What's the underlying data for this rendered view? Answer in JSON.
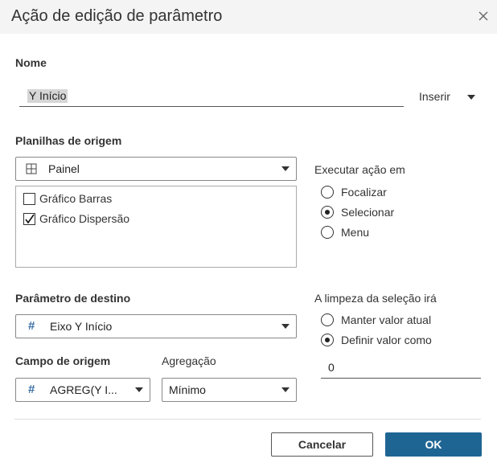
{
  "dialog": {
    "title": "Ação de edição de parâmetro",
    "close_icon": "close-icon"
  },
  "name_section": {
    "label": "Nome",
    "value": "Y Início",
    "insert_label": "Inserir"
  },
  "source_sheets": {
    "label": "Planilhas de origem",
    "selected": "Painel",
    "icon": "grid-icon",
    "items": [
      {
        "label": "Gráfico Barras",
        "checked": false
      },
      {
        "label": "Gráfico Dispersão",
        "checked": true
      }
    ]
  },
  "run_action": {
    "label": "Executar ação em",
    "options": [
      {
        "label": "Focalizar",
        "selected": false
      },
      {
        "label": "Selecionar",
        "selected": true
      },
      {
        "label": "Menu",
        "selected": false
      }
    ]
  },
  "target_parameter": {
    "label": "Parâmetro de destino",
    "selected": "Eixo Y Início",
    "icon": "number-icon"
  },
  "source_field": {
    "label": "Campo de origem",
    "selected": "AGREG(Y I...",
    "icon": "number-icon"
  },
  "aggregation": {
    "label": "Agregação",
    "selected": "Mínimo"
  },
  "clearing": {
    "label": "A limpeza da seleção irá",
    "options": [
      {
        "label": "Manter valor atual",
        "selected": false
      },
      {
        "label": "Definir valor como",
        "selected": true
      }
    ],
    "value": "0"
  },
  "buttons": {
    "cancel": "Cancelar",
    "ok": "OK"
  },
  "colors": {
    "primary": "#1f6594",
    "titlebar": "#f4f4f4",
    "hash": "#3a6ea5"
  }
}
